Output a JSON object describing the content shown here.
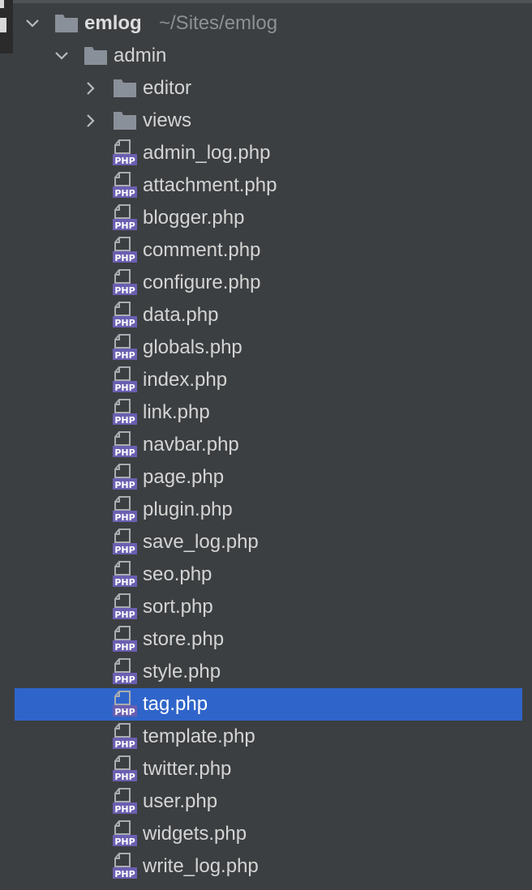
{
  "project_tree": {
    "root": {
      "name": "emlog",
      "path": "~/Sites/emlog"
    },
    "folder": {
      "name": "admin"
    },
    "subfolders": [
      {
        "name": "editor"
      },
      {
        "name": "views"
      }
    ],
    "files": [
      {
        "name": "admin_log.php"
      },
      {
        "name": "attachment.php"
      },
      {
        "name": "blogger.php"
      },
      {
        "name": "comment.php"
      },
      {
        "name": "configure.php"
      },
      {
        "name": "data.php"
      },
      {
        "name": "globals.php"
      },
      {
        "name": "index.php"
      },
      {
        "name": "link.php"
      },
      {
        "name": "navbar.php"
      },
      {
        "name": "page.php"
      },
      {
        "name": "plugin.php"
      },
      {
        "name": "save_log.php"
      },
      {
        "name": "seo.php"
      },
      {
        "name": "sort.php"
      },
      {
        "name": "store.php"
      },
      {
        "name": "style.php"
      },
      {
        "name": "tag.php",
        "selected": true
      },
      {
        "name": "template.php"
      },
      {
        "name": "twitter.php"
      },
      {
        "name": "user.php"
      },
      {
        "name": "widgets.php"
      },
      {
        "name": "write_log.php"
      }
    ],
    "icon_names": {
      "folder": "folder-icon",
      "php": "php-file-icon",
      "expanded": "chevron-down-icon",
      "collapsed": "chevron-right-icon"
    },
    "colors": {
      "background": "#3c3f41",
      "selection": "#2f65ca",
      "folder": "#8a9099",
      "php_badge": "#6a5fb1",
      "text": "#d4d4d4",
      "path_text": "#8e9194"
    }
  }
}
